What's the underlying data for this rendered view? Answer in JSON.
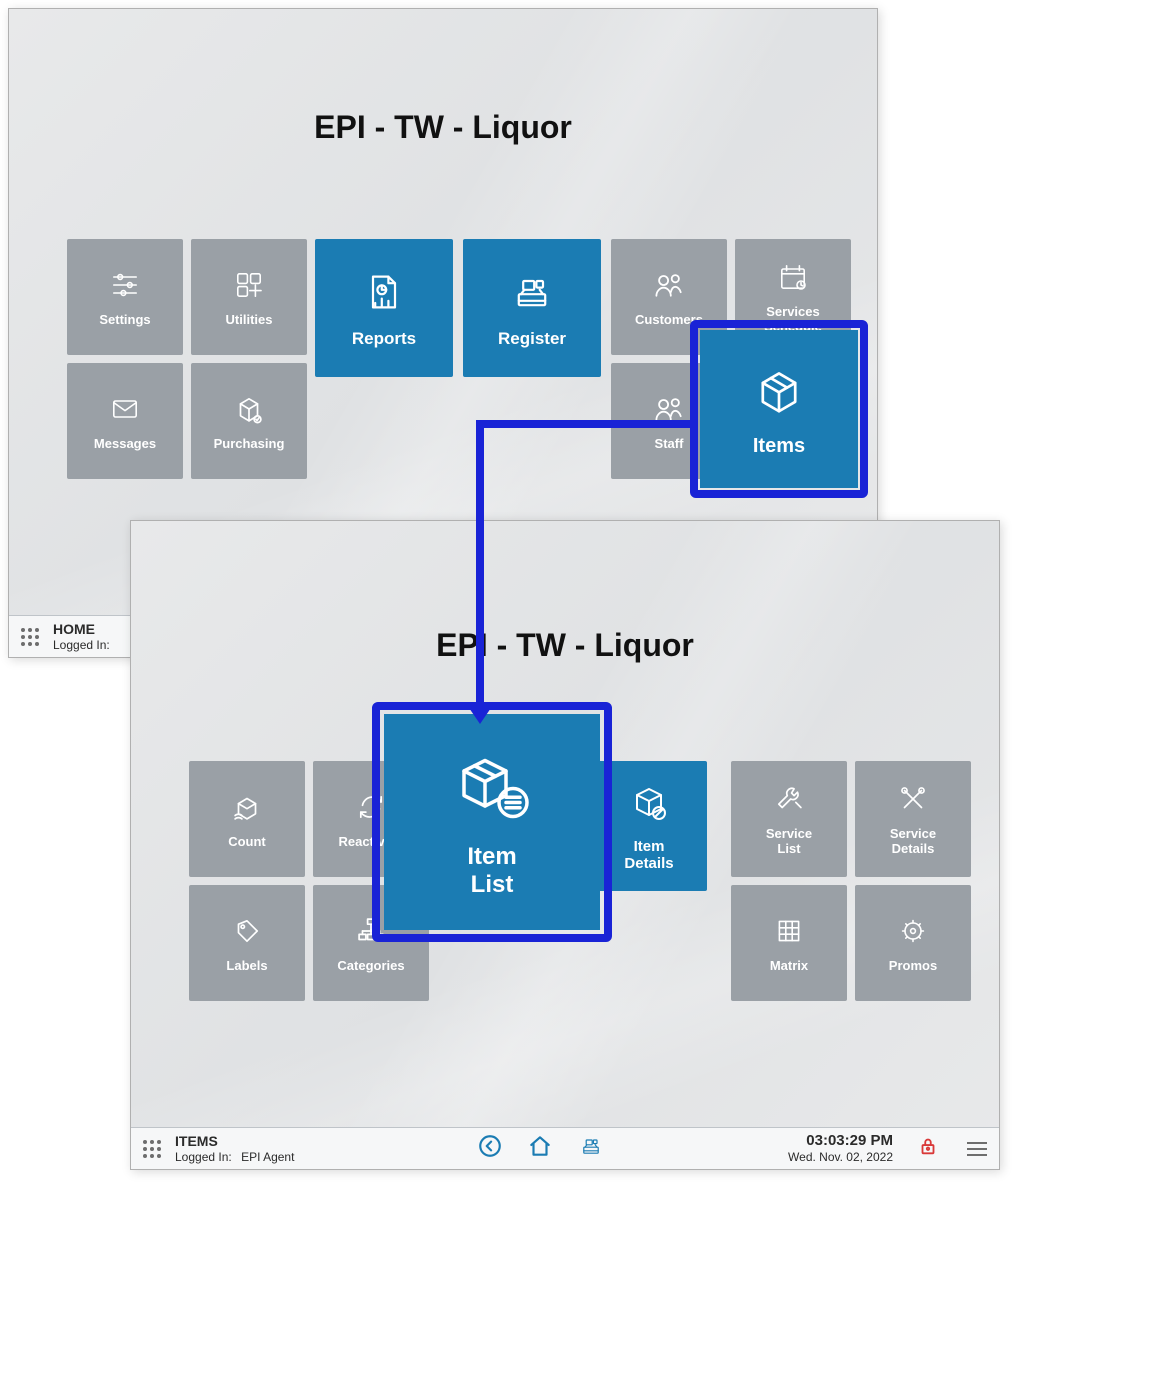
{
  "app_title": "EPI - TW - Liquor",
  "highlight": {
    "top_tile": "items",
    "sub_tile": "item_list"
  },
  "home": {
    "tiles": {
      "settings": "Settings",
      "utilities": "Utilities",
      "reports": "Reports",
      "register": "Register",
      "customers": "Customers",
      "services_schedule": "Services\nSchedule",
      "messages": "Messages",
      "purchasing": "Purchasing",
      "staff": "Staff",
      "items": "Items"
    },
    "status": {
      "title": "HOME",
      "logged_in_label": "Logged In:"
    }
  },
  "items_screen": {
    "tiles": {
      "count": "Count",
      "reactivate": "Reactivate",
      "item_list": "Item\nList",
      "item_details": "Item\nDetails",
      "service_list": "Service\nList",
      "service_details": "Service\nDetails",
      "labels": "Labels",
      "categories": "Categories",
      "matrix": "Matrix",
      "promos": "Promos"
    },
    "status": {
      "title": "ITEMS",
      "logged_in_label": "Logged In:",
      "logged_in_user": "EPI Agent",
      "time": "03:03:29 PM",
      "date": "Wed. Nov. 02, 2022"
    }
  }
}
